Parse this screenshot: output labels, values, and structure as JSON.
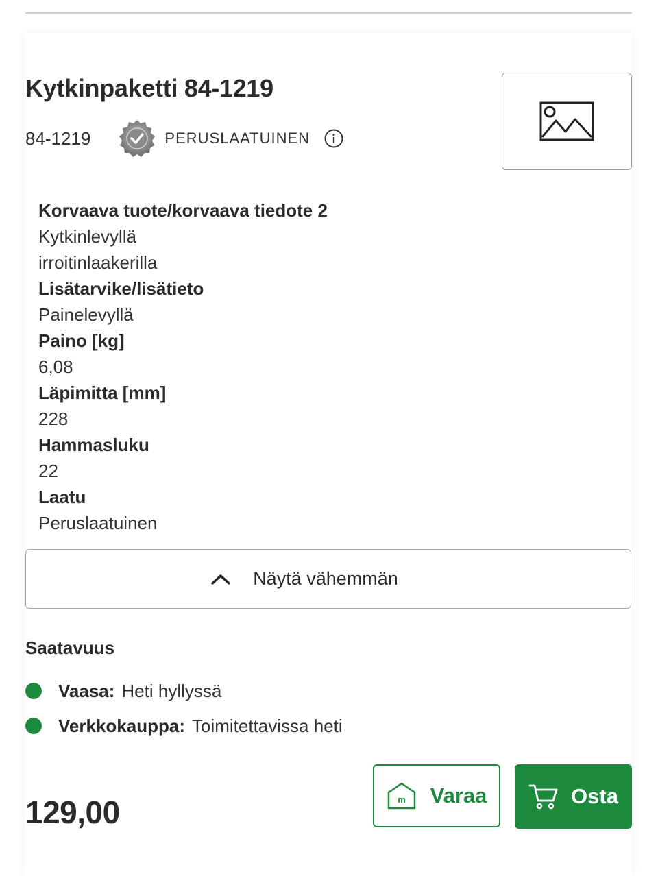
{
  "product": {
    "title": "Kytkinpaketti 84-1219",
    "code": "84-1219",
    "quality_badge_label": "PERUSLAATUINEN",
    "quality_badge_icon": "quality-badge-icon",
    "info_icon": "info-icon",
    "image_icon": "image-placeholder-icon"
  },
  "specs": [
    {
      "type": "label",
      "text": "Korvaava tuote/korvaava tiedote 2"
    },
    {
      "type": "value",
      "text": "Kytkinlevyllä"
    },
    {
      "type": "value",
      "text": "irroitinlaakerilla"
    },
    {
      "type": "label",
      "text": "Lisätarvike/lisätieto"
    },
    {
      "type": "value",
      "text": "Painelevyllä"
    },
    {
      "type": "label",
      "text": "Paino [kg]"
    },
    {
      "type": "value",
      "text": "6,08"
    },
    {
      "type": "label",
      "text": "Läpimitta [mm]"
    },
    {
      "type": "value",
      "text": "228"
    },
    {
      "type": "label",
      "text": "Hammasluku"
    },
    {
      "type": "value",
      "text": "22"
    },
    {
      "type": "label",
      "text": "Laatu"
    },
    {
      "type": "value",
      "text": "Peruslaatuinen"
    }
  ],
  "toggle": {
    "label": "Näytä vähemmän",
    "icon": "chevron-up-icon"
  },
  "availability": {
    "title": "Saatavuus",
    "items": [
      {
        "store": "Vaasa:",
        "status": "Heti hyllyssä",
        "color": "#1e8a3e"
      },
      {
        "store": "Verkkokauppa:",
        "status": "Toimitettavissa heti",
        "color": "#1e8a3e"
      }
    ]
  },
  "purchase": {
    "price": "129,00",
    "reserve_label": "Varaa",
    "reserve_icon": "store-icon",
    "buy_label": "Osta",
    "buy_icon": "cart-icon"
  },
  "colors": {
    "accent_green": "#1e8a3e",
    "text": "#2b2b2b"
  }
}
